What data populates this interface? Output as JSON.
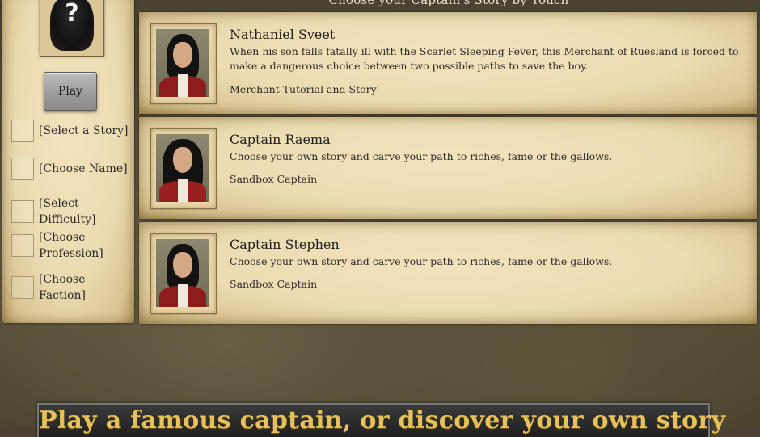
{
  "header": {
    "title": "Choose your Captain's Story by Touch"
  },
  "sidebar": {
    "portrait_icon": "unknown-captain-icon",
    "portrait_glyph": "?",
    "play_label": "Play",
    "steps": [
      "[Select a Story]",
      "[Choose Name]",
      "[Select Difficulty]",
      "[Choose Profession]",
      "[Choose Faction]"
    ]
  },
  "stories": [
    {
      "name": "Nathaniel Sveet",
      "description": "When his son falls fatally ill with the Scarlet Sleeping Fever, this Merchant of Ruesland is forced to make a dangerous choice between two possible paths to save the boy.",
      "type": "Merchant Tutorial and Story"
    },
    {
      "name": "Captain Raema",
      "description": "Choose your own story and carve your path to riches, fame or the gallows.",
      "type": "Sandbox Captain"
    },
    {
      "name": "Captain Stephen",
      "description": "Choose your own story and carve your path to riches, fame or the gallows.",
      "type": "Sandbox Captain"
    }
  ],
  "banner": {
    "text": "Play a famous captain, or discover your own story"
  },
  "colors": {
    "parchment": "#ecdcb2",
    "banner_text": "#e6c15a",
    "coat_red": "#8e1c1c"
  }
}
